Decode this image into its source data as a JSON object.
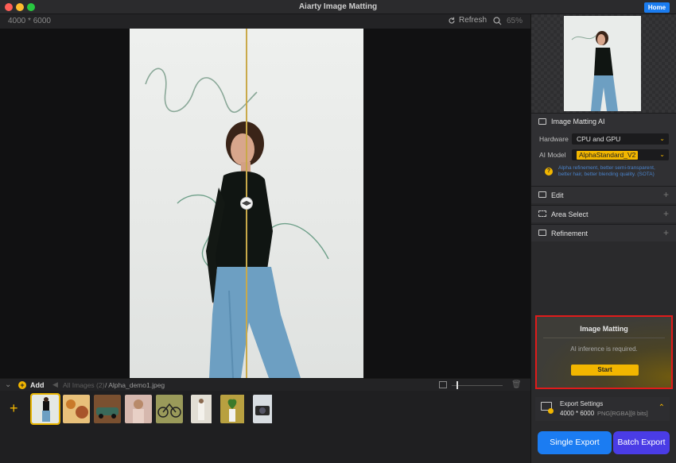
{
  "window": {
    "title": "Aiarty Image Matting",
    "home_label": "Home"
  },
  "toolbar": {
    "dimensions": "4000 * 6000",
    "refresh_label": "Refresh",
    "zoom": "65%"
  },
  "filmstrip_bar": {
    "add_label": "Add",
    "all_images": "All Images (2)",
    "current_file": "/ Alpha_demo1.jpeg"
  },
  "filmstrip": {
    "thumbnails": [
      {
        "name": "thumb-woman-jeans",
        "color": "#9db8a8",
        "selected": true
      },
      {
        "name": "thumb-food",
        "color": "#c98a3a",
        "selected": false
      },
      {
        "name": "thumb-car",
        "color": "#6f4a2e",
        "selected": false
      },
      {
        "name": "thumb-woman-pink",
        "color": "#c9a8a0",
        "selected": false
      },
      {
        "name": "thumb-bicycle",
        "color": "#8a8a40",
        "selected": false
      },
      {
        "name": "thumb-woman-white",
        "color": "#d8d3c8",
        "selected": false
      },
      {
        "name": "thumb-plant",
        "color": "#9a8a30",
        "selected": false
      },
      {
        "name": "thumb-camera",
        "color": "#5a6a7a",
        "selected": false
      }
    ]
  },
  "panel": {
    "matting_ai": {
      "title": "Image Matting AI",
      "hardware_label": "Hardware",
      "hardware_value": "CPU and GPU",
      "model_label": "AI Model",
      "model_value": "AlphaStandard_V2",
      "note": "Alpha refinement, better semi-transparent, better hair, better blending quality. (SOTA)"
    },
    "edit": {
      "title": "Edit"
    },
    "area_select": {
      "title": "Area Select"
    },
    "refinement": {
      "title": "Refinement"
    },
    "matting_box": {
      "title": "Image Matting",
      "message": "AI inference is required.",
      "start_label": "Start"
    },
    "export": {
      "title": "Export Settings",
      "dims": "4000 * 6000",
      "format": "PNG[RGBA][8 bits]"
    },
    "single_export": "Single Export",
    "batch_export": "Batch Export"
  },
  "colors": {
    "accent": "#f2b600",
    "blue": "#1b7cf2",
    "purple": "#4a3ce6",
    "highlight_border": "#e01b1b"
  }
}
